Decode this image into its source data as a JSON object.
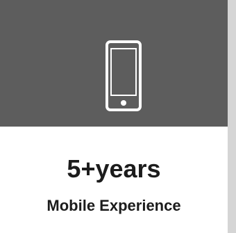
{
  "card": {
    "icon": "mobile-phone-icon",
    "value": "5+years",
    "caption": "Mobile Experience"
  },
  "colors": {
    "header_bg": "#5d5d5d",
    "icon_stroke": "#ffffff",
    "card_bg": "#ffffff",
    "text": "#1c1c1c",
    "page_bg": "#d5d5d5"
  }
}
